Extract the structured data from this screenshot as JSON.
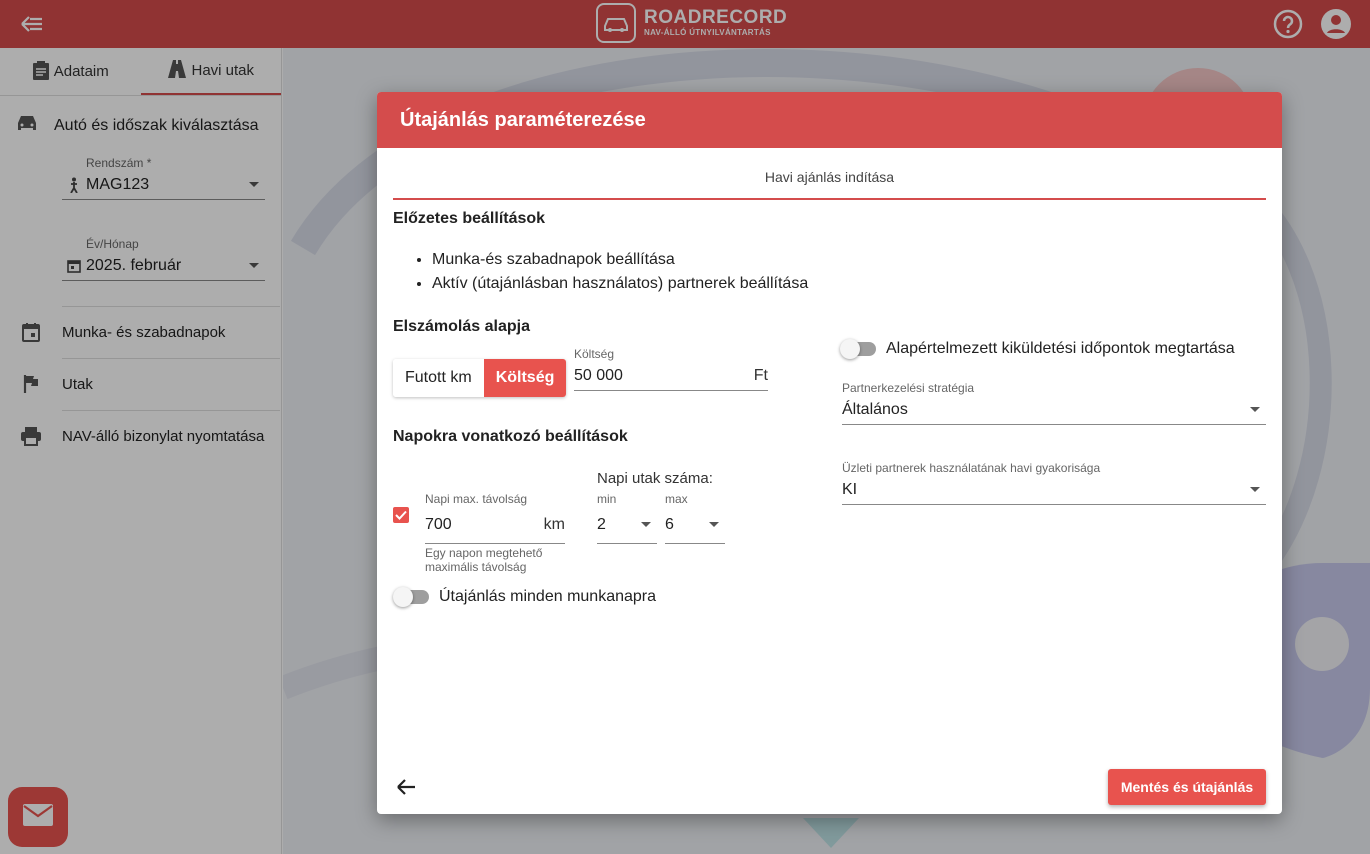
{
  "header": {
    "brand_name": "ROADRECORD",
    "brand_tagline": "NAV-ÁLLÓ ÚTNYILVÁNTARTÁS",
    "color": "#d44c4c"
  },
  "sidebar": {
    "tabs": [
      {
        "label": "Adataim",
        "icon": "clipboard-icon"
      },
      {
        "label": "Havi utak",
        "icon": "road-icon"
      }
    ],
    "section_title": "Autó és időszak kiválasztása",
    "plate": {
      "label": "Rendszám *",
      "value": "MAG123"
    },
    "period": {
      "label": "Év/Hónap",
      "value": "2025. február"
    },
    "nav": [
      {
        "label": "Munka- és szabadnapok",
        "icon": "calendar-icon"
      },
      {
        "label": "Utak",
        "icon": "flag-icon"
      },
      {
        "label": "NAV-álló bizonylat nyomtatása",
        "icon": "printer-icon"
      }
    ]
  },
  "dialog": {
    "title": "Útajánlás paraméterezése",
    "step": "Havi ajánlás indítása",
    "prior_settings_title": "Előzetes beállítások",
    "bullets": [
      "Munka-és szabadnapok beállítása",
      "Aktív (útajánlásban használatos) partnerek beállítása"
    ],
    "billing": {
      "title": "Elszámolás alapja",
      "options": [
        "Futott km",
        "Költség"
      ],
      "selected": "Költség",
      "cost_label": "Költség",
      "cost_value": "50 000",
      "cost_unit": "Ft"
    },
    "keep_times_label": "Alapértelmezett kiküldetési időpontok megtartása",
    "strategy": {
      "label": "Partnerkezelési stratégia",
      "value": "Általános"
    },
    "frequency": {
      "label": "Üzleti partnerek használatának havi gyakorisága",
      "value": "KI"
    },
    "daily_title": "Napokra vonatkozó beállítások",
    "max_distance": {
      "label": "Napi max. távolság",
      "value": "700",
      "unit": "km",
      "hint": "Egy napon megtehető maximális távolság"
    },
    "daily_trips": {
      "title": "Napi utak száma:",
      "min_label": "min",
      "min_value": "2",
      "max_label": "max",
      "max_value": "6"
    },
    "every_workday_label": "Útajánlás minden munkanapra",
    "save_label": "Mentés és útajánlás"
  }
}
